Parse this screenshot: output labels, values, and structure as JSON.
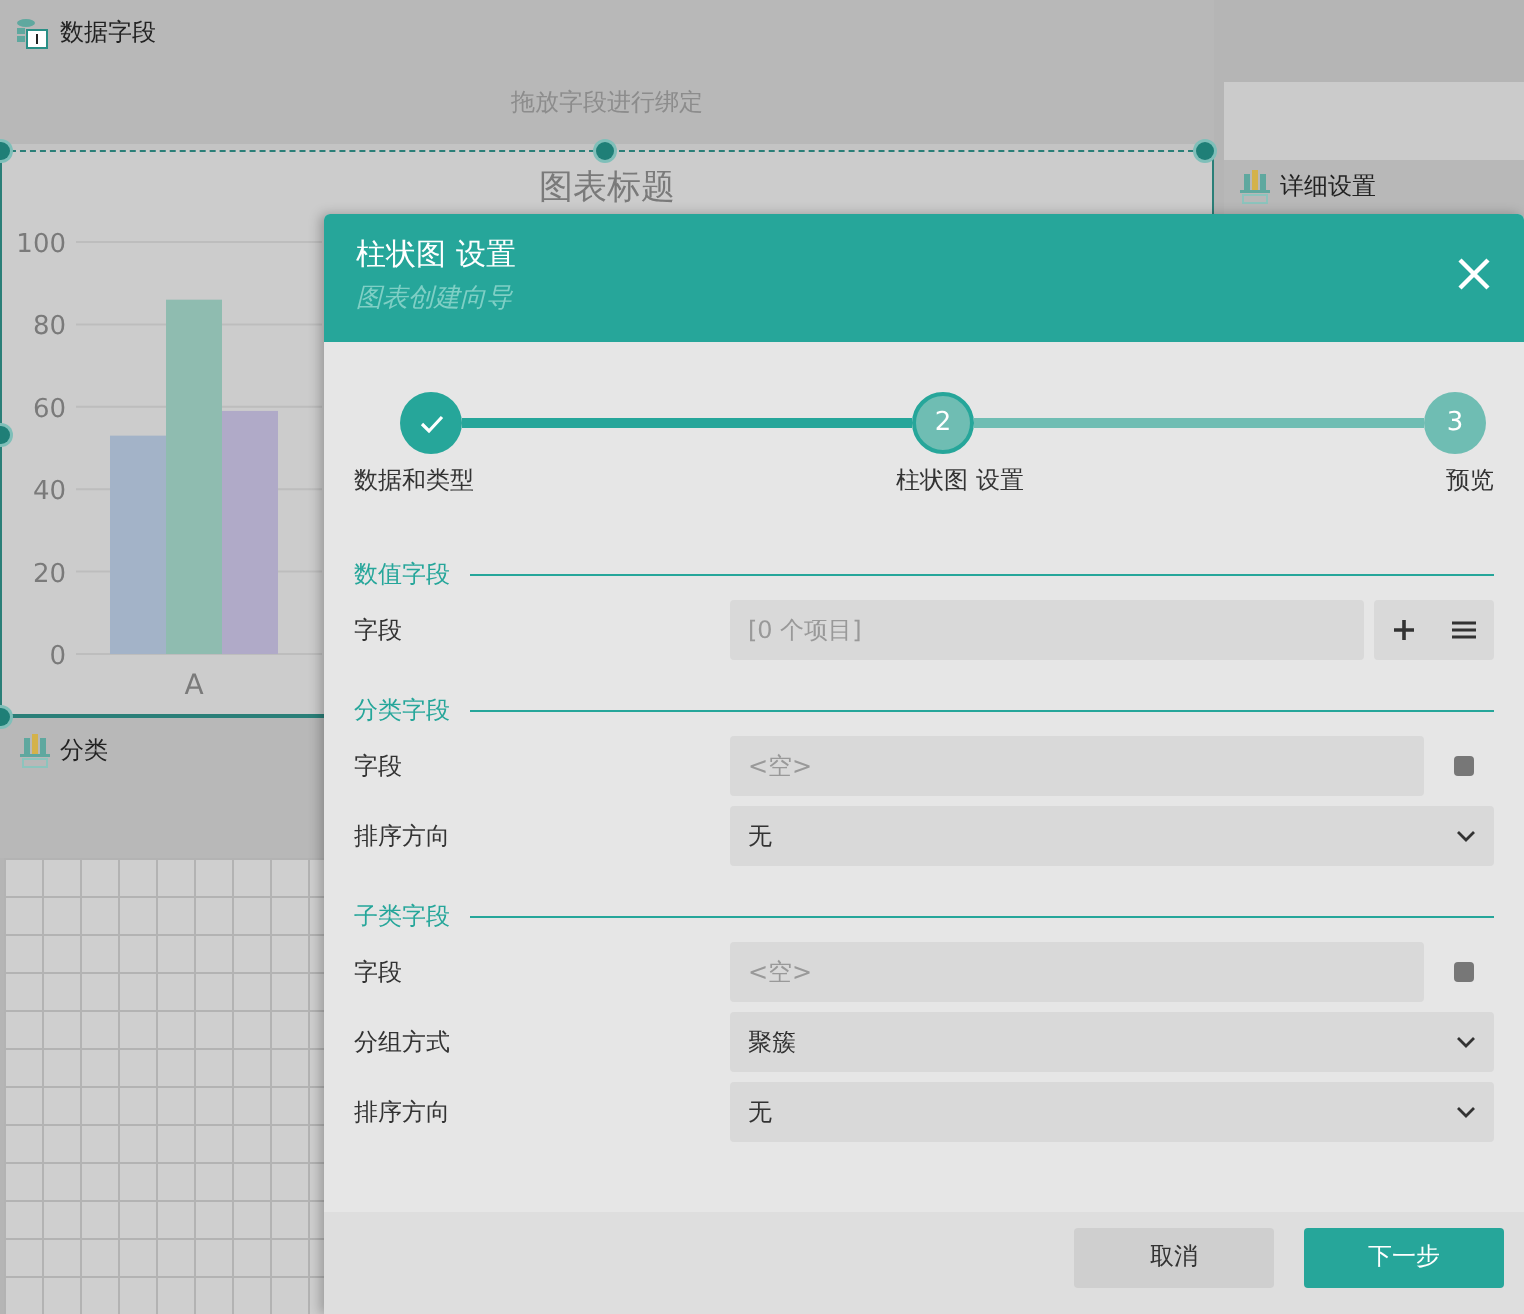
{
  "designer": {
    "data_panel": {
      "title": "数据字段",
      "hint": "拖放字段进行绑定"
    },
    "chart": {
      "title": "图表标题",
      "chart_data": {
        "type": "bar",
        "categories": [
          "A"
        ],
        "series": [
          {
            "color": "#a3b3c8",
            "values": [
              53
            ]
          },
          {
            "color": "#8fbcb0",
            "values": [
              86
            ]
          },
          {
            "color": "#b0aac8",
            "values": [
              59
            ]
          }
        ],
        "ylim": [
          0,
          100
        ],
        "grid": true,
        "yticks": [
          0,
          20,
          40,
          60,
          80,
          100
        ]
      }
    },
    "category_panel": {
      "title": "分类"
    },
    "detail_panel": {
      "title": "详细设置"
    }
  },
  "dialog": {
    "title": "柱状图 设置",
    "subtitle": "图表创建向导",
    "steps": [
      {
        "label": "数据和类型",
        "kind": "done"
      },
      {
        "label": "柱状图 设置",
        "number": "2",
        "kind": "current"
      },
      {
        "label": "预览",
        "number": "3",
        "kind": "pending"
      }
    ],
    "sections": [
      {
        "title": "数值字段",
        "rows": [
          {
            "label": "字段",
            "kind": "list",
            "placeholder": "[0 个项目]"
          }
        ]
      },
      {
        "title": "分类字段",
        "rows": [
          {
            "label": "字段",
            "kind": "field",
            "placeholder": "<空>"
          },
          {
            "label": "排序方向",
            "kind": "select",
            "value": "无"
          }
        ]
      },
      {
        "title": "子类字段",
        "rows": [
          {
            "label": "字段",
            "kind": "field",
            "placeholder": "<空>"
          },
          {
            "label": "分组方式",
            "kind": "select",
            "value": "聚簇"
          },
          {
            "label": "排序方向",
            "kind": "select",
            "value": "无"
          }
        ]
      }
    ],
    "buttons": [
      {
        "label": "取消",
        "kind": "secondary"
      },
      {
        "label": "下一步",
        "kind": "primary"
      }
    ]
  }
}
